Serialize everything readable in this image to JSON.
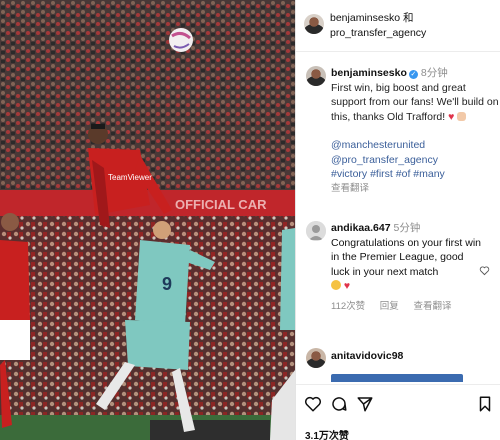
{
  "header": {
    "account_1": "benjaminsesko",
    "connector": "和",
    "account_2": "pro_transfer_agency"
  },
  "caption": {
    "username": "benjaminsesko",
    "verified_icon": "✓",
    "time": "8分钟",
    "text": "First win, big boost and great support from our fans! We'll build on this, thanks Old Trafford!",
    "heart": "♥",
    "mention_1": "@manchesterunited",
    "mention_2": "@pro_transfer_agency",
    "hashtags": "#victory #first #of #many",
    "translate": "查看翻译"
  },
  "comment": {
    "username": "andikaa.647",
    "time": "5分钟",
    "text": "Congratulations on your first win in the Premier League, good luck in your next match",
    "heart": "♥",
    "likes": "112次赞",
    "reply": "回复",
    "translate": "查看翻译"
  },
  "comment2": {
    "username": "anitavidovic98"
  },
  "footer": {
    "likes": "3.1万次赞"
  },
  "icons": {
    "like": "heart-outline-icon",
    "comment": "comment-icon",
    "share": "send-icon",
    "save": "bookmark-icon"
  },
  "colors": {
    "hashtag": "#3b5f9a",
    "verified": "#3897f0",
    "red_heart": "#e0334a"
  }
}
